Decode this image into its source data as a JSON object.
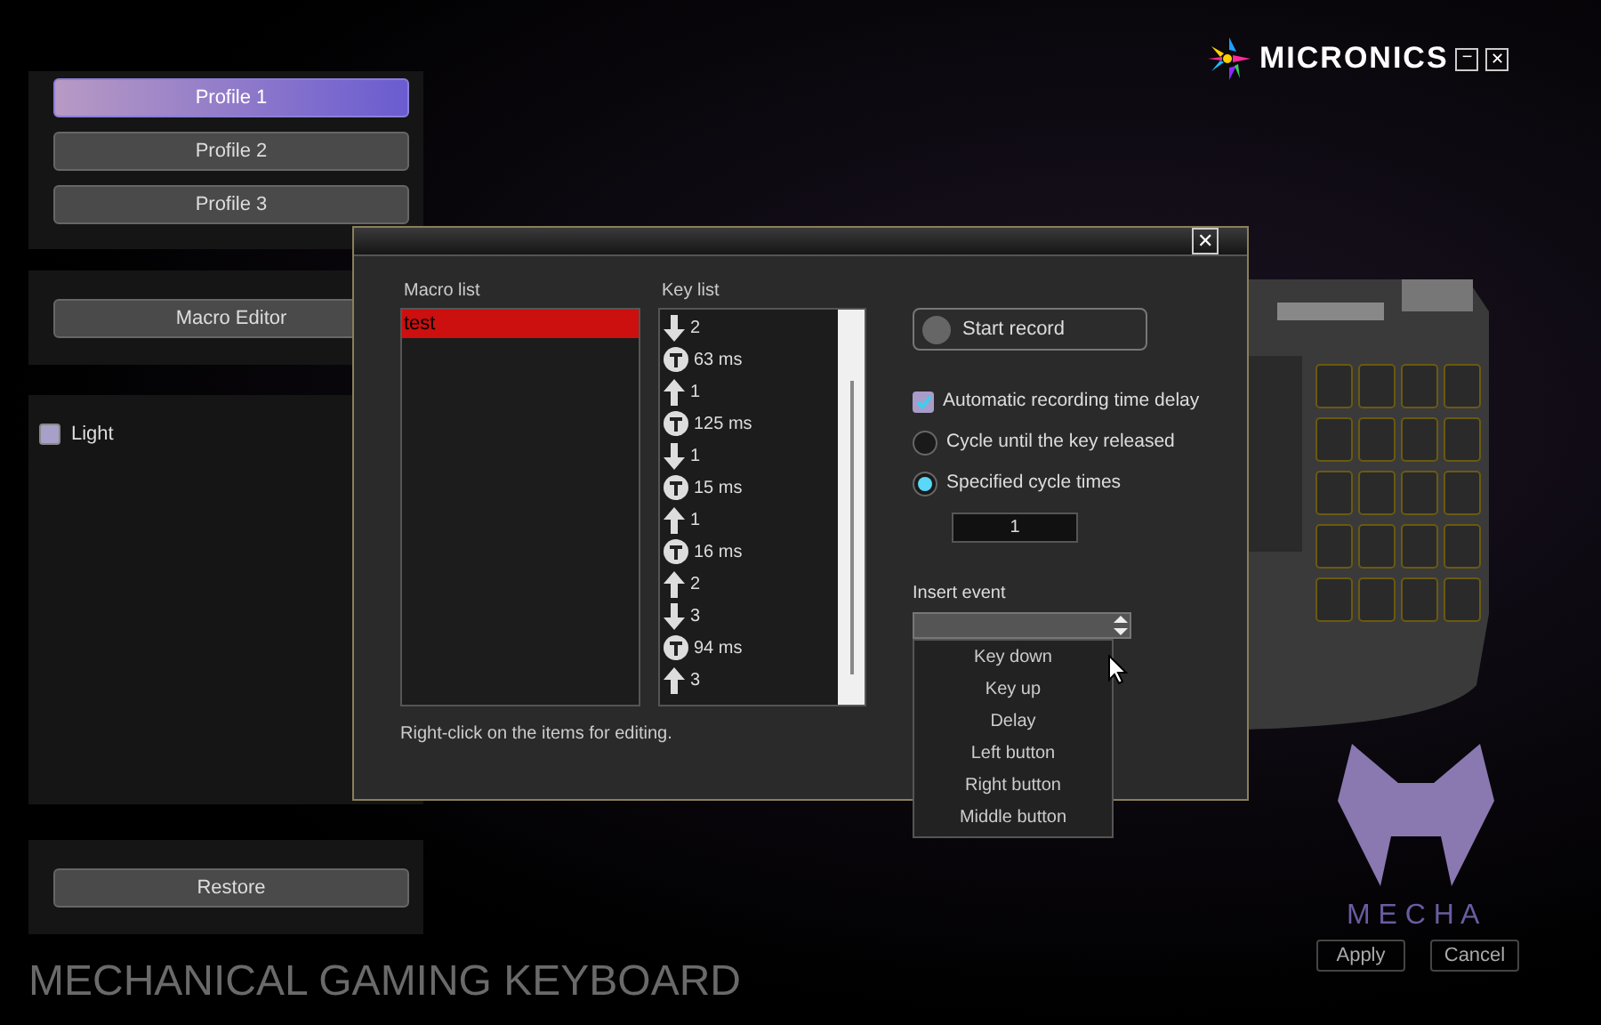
{
  "brand": {
    "logo_text": "MICRONICS",
    "minimize": "−",
    "close": "✕"
  },
  "profiles": [
    {
      "label": "Profile 1",
      "selected": true
    },
    {
      "label": "Profile 2",
      "selected": false
    },
    {
      "label": "Profile 3",
      "selected": false
    }
  ],
  "macro_editor_button": "Macro Editor",
  "light": {
    "label": "Light",
    "checked": false
  },
  "restore_button": "Restore",
  "product_title": "MECHANICAL GAMING KEYBOARD",
  "mecha_text": "M E C H A",
  "footer_buttons": [
    "Apply",
    "Cancel"
  ],
  "dialog": {
    "close": "✕",
    "macro_list": {
      "label": "Macro list",
      "items": [
        {
          "text": "test",
          "selected": true
        }
      ]
    },
    "key_list": {
      "label": "Key list",
      "items": [
        {
          "kind": "down",
          "text": "2"
        },
        {
          "kind": "delay",
          "text": "63 ms"
        },
        {
          "kind": "up",
          "text": "1"
        },
        {
          "kind": "delay",
          "text": "125 ms"
        },
        {
          "kind": "down",
          "text": "1"
        },
        {
          "kind": "delay",
          "text": "15 ms"
        },
        {
          "kind": "up",
          "text": "1"
        },
        {
          "kind": "delay",
          "text": "16 ms"
        },
        {
          "kind": "up",
          "text": "2"
        },
        {
          "kind": "down",
          "text": "3"
        },
        {
          "kind": "delay",
          "text": "94 ms"
        },
        {
          "kind": "up",
          "text": "3"
        }
      ]
    },
    "start_record": "Start record",
    "options": [
      {
        "kind": "checkbox",
        "label": "Automatic recording time delay",
        "checked": true
      },
      {
        "kind": "radio",
        "label": "Cycle until the key released",
        "selected": false
      },
      {
        "kind": "radio",
        "label": "Specified cycle times",
        "selected": true
      }
    ],
    "cycle_times": "1",
    "insert_event": {
      "label": "Insert event",
      "expanded": true,
      "options": [
        "Key down",
        "Key up",
        "Delay",
        "Left button",
        "Right button",
        "Middle button"
      ]
    },
    "hint": "Right-click on the items for editing."
  }
}
